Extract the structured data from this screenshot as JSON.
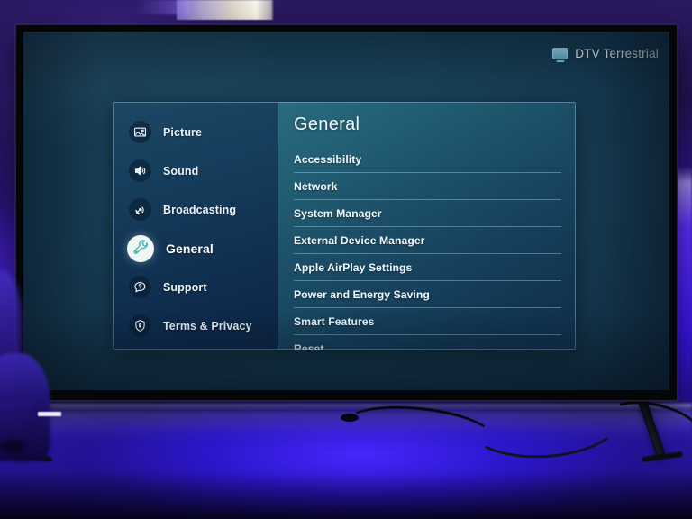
{
  "device": {
    "type": "television",
    "on_screen_ui": "Samsung Tizen TV Settings"
  },
  "screen": {
    "source_badge": {
      "icon": "tv-icon",
      "label": "DTV Terrestrial"
    },
    "settings_panel": {
      "sidebar": {
        "items": [
          {
            "label": "Picture",
            "icon": "picture-icon",
            "selected": false
          },
          {
            "label": "Sound",
            "icon": "speaker-icon",
            "selected": false
          },
          {
            "label": "Broadcasting",
            "icon": "satellite-icon",
            "selected": false
          },
          {
            "label": "General",
            "icon": "wrench-icon",
            "selected": true
          },
          {
            "label": "Support",
            "icon": "help-bubble-icon",
            "selected": false
          },
          {
            "label": "Terms & Privacy",
            "icon": "shield-lock-icon",
            "selected": false
          }
        ]
      },
      "content": {
        "title": "General",
        "options": [
          {
            "label": "Accessibility",
            "clipped": false
          },
          {
            "label": "Network",
            "clipped": false
          },
          {
            "label": "System Manager",
            "clipped": false
          },
          {
            "label": "External Device Manager",
            "clipped": false
          },
          {
            "label": "Apple AirPlay Settings",
            "clipped": false
          },
          {
            "label": "Power and Energy Saving",
            "clipped": false
          },
          {
            "label": "Smart Features",
            "clipped": false
          },
          {
            "label": "Reset",
            "clipped": true
          }
        ]
      }
    }
  },
  "colors": {
    "screen_background": "#163a52",
    "panel_sidebar": "#123455",
    "panel_content": "#1c5068",
    "selected_icon_bg": "#f2f6f3",
    "selected_icon_stroke": "#3fb6ac",
    "text_primary": "#f2f8fb",
    "divider": "#b4d6e8",
    "wall_purple": "#231456",
    "desk_blue": "#3320c0",
    "bezel": "#050608"
  }
}
